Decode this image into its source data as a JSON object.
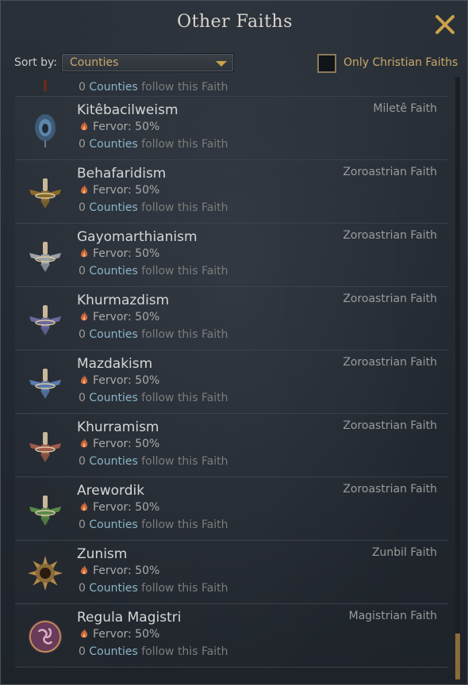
{
  "window": {
    "title": "Other Faiths"
  },
  "controls": {
    "sort_label": "Sort by:",
    "sort_value": "Counties",
    "filter_label": "Only Christian Faiths",
    "filter_checked": false
  },
  "partial_row": {
    "count": "0",
    "counties_word": "Counties",
    "follow_text": "follow this Faith"
  },
  "faiths": [
    {
      "name": "Kitêbacilweism",
      "faith": "Miletê Faith",
      "fervor": "Fervor: 50%",
      "count": "0",
      "counties_word": "Counties",
      "follow_text": "follow this Faith",
      "icon": "peacock-feather-icon"
    },
    {
      "name": "Behafaridism",
      "faith": "Zoroastrian Faith",
      "fervor": "Fervor: 50%",
      "count": "0",
      "counties_word": "Counties",
      "follow_text": "follow this Faith",
      "icon": "faravahar-icon",
      "color": "#8a6a2a"
    },
    {
      "name": "Gayomarthianism",
      "faith": "Zoroastrian Faith",
      "fervor": "Fervor: 50%",
      "count": "0",
      "counties_word": "Counties",
      "follow_text": "follow this Faith",
      "icon": "faravahar-icon",
      "color": "#9aa0a6"
    },
    {
      "name": "Khurmazdism",
      "faith": "Zoroastrian Faith",
      "fervor": "Fervor: 50%",
      "count": "0",
      "counties_word": "Counties",
      "follow_text": "follow this Faith",
      "icon": "faravahar-icon",
      "color": "#6a6aa0"
    },
    {
      "name": "Mazdakism",
      "faith": "Zoroastrian Faith",
      "fervor": "Fervor: 50%",
      "count": "0",
      "counties_word": "Counties",
      "follow_text": "follow this Faith",
      "icon": "faravahar-icon",
      "color": "#5a7ab0"
    },
    {
      "name": "Khurramism",
      "faith": "Zoroastrian Faith",
      "fervor": "Fervor: 50%",
      "count": "0",
      "counties_word": "Counties",
      "follow_text": "follow this Faith",
      "icon": "faravahar-icon",
      "color": "#a05a4a"
    },
    {
      "name": "Arewordik",
      "faith": "Zoroastrian Faith",
      "fervor": "Fervor: 50%",
      "count": "0",
      "counties_word": "Counties",
      "follow_text": "follow this Faith",
      "icon": "faravahar-icon",
      "color": "#5a8a4a"
    },
    {
      "name": "Zunism",
      "faith": "Zunbil Faith",
      "fervor": "Fervor: 50%",
      "count": "0",
      "counties_word": "Counties",
      "follow_text": "follow this Faith",
      "icon": "sun-icon"
    },
    {
      "name": "Regula Magistri",
      "faith": "Magistrian Faith",
      "fervor": "Fervor: 50%",
      "count": "0",
      "counties_word": "Counties",
      "follow_text": "follow this Faith",
      "icon": "triskelion-icon"
    }
  ],
  "colors": {
    "accent": "#c9a24a",
    "counties": "#8ab4c8",
    "background": "#232931"
  }
}
